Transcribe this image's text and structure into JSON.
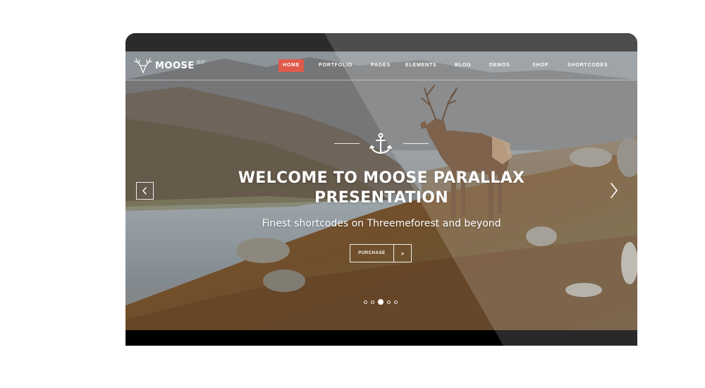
{
  "brand": {
    "name": "MOOSE",
    "superscript": "WP",
    "logo_icon": "deer-antlers-icon"
  },
  "nav": {
    "items": [
      {
        "label": "HOME",
        "active": true
      },
      {
        "label": "PORTFOLIO",
        "active": false
      },
      {
        "label": "PAGES",
        "active": false
      },
      {
        "label": "ELEMENTS",
        "active": false
      },
      {
        "label": "BLOG",
        "active": false
      },
      {
        "label": "DEMOS",
        "active": false
      },
      {
        "label": "SHOP",
        "active": false
      },
      {
        "label": "SHORTCODES",
        "active": false
      }
    ],
    "active_color": "#e05a4b"
  },
  "hero": {
    "icon": "anchor-icon",
    "title_line1": "WELCOME TO MOOSE PARALLAX",
    "title_line2": "PRESENTATION",
    "subtitle": "Finest shortcodes on Threemeforest and beyond",
    "button": {
      "label": "PURCHASE",
      "arrow": "»"
    }
  },
  "slider": {
    "prev_icon": "chevron-left-icon",
    "next_icon": "chevron-right-icon",
    "dot_count": 5,
    "active_dot": 2
  }
}
